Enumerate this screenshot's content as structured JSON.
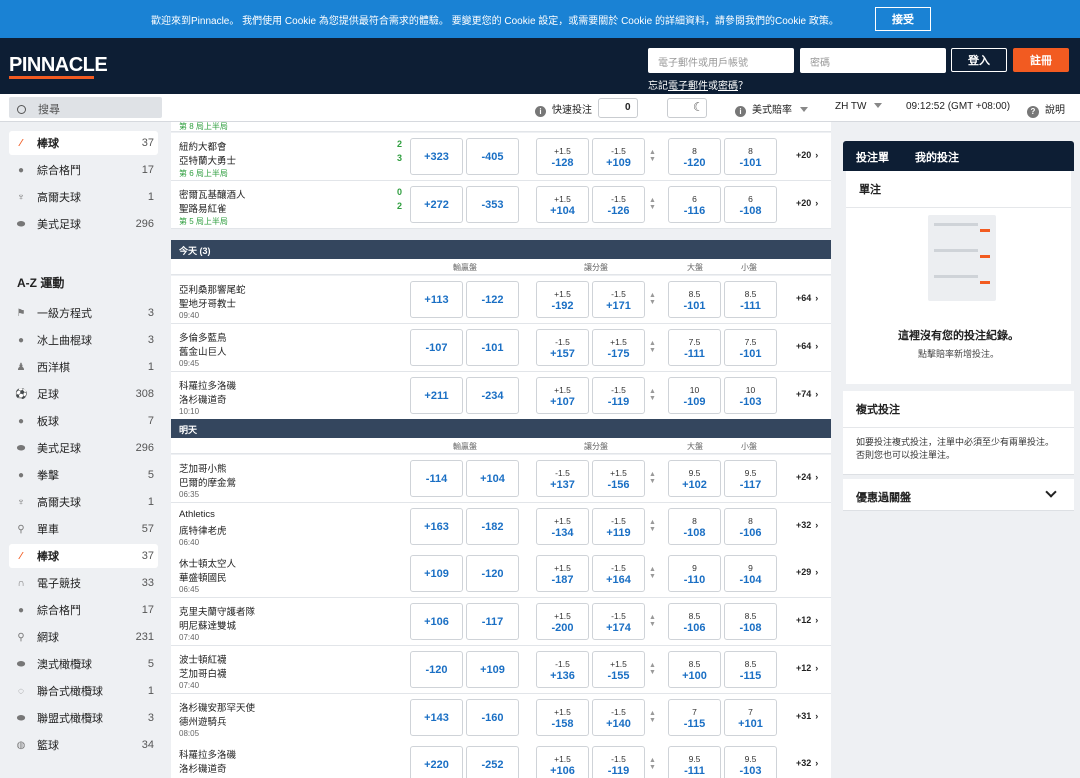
{
  "cookie": {
    "text": "歡迎來到Pinnacle。 我們使用 Cookie 為您提供最符合需求的體驗。 要變更您的 Cookie 設定，或需要關於 Cookie 的詳細資料，請參閱我們的Cookie 政策。",
    "accept": "接受"
  },
  "header": {
    "logo": "PINNACLE",
    "email_placeholder": "電子郵件或用戶帳號",
    "password_placeholder": "密碼",
    "login": "登入",
    "signup": "註冊",
    "forgot_prefix": "忘記",
    "forgot_email": "電子郵件",
    "forgot_or": "或",
    "forgot_password": "密碼",
    "forgot_suffix": "？"
  },
  "toolbar": {
    "search": "搜尋",
    "quick_bet": "快速投注",
    "quick_bet_value": "0",
    "odds_format": "美式賠率",
    "language": "ZH TW",
    "clock": "09:12:52 (GMT +08:00)",
    "help": "說明"
  },
  "sidebar": {
    "top": [
      {
        "label": "棒球",
        "count": "37",
        "icon": "baseball-bat-icon",
        "active": true
      },
      {
        "label": "綜合格鬥",
        "count": "17",
        "icon": "mma-glove-icon"
      },
      {
        "label": "高爾夫球",
        "count": "1",
        "icon": "golf-icon"
      },
      {
        "label": "美式足球",
        "count": "296",
        "icon": "football-icon"
      }
    ],
    "az_title": "A-Z 運動",
    "az": [
      {
        "label": "一級方程式",
        "count": "3",
        "icon": "racing-flag-icon"
      },
      {
        "label": "冰上曲棍球",
        "count": "3",
        "icon": "hockey-puck-icon"
      },
      {
        "label": "西洋棋",
        "count": "1",
        "icon": "chess-icon"
      },
      {
        "label": "足球",
        "count": "308",
        "icon": "soccer-ball-icon"
      },
      {
        "label": "板球",
        "count": "7",
        "icon": "cricket-ball-icon"
      },
      {
        "label": "美式足球",
        "count": "296",
        "icon": "football-icon"
      },
      {
        "label": "拳擊",
        "count": "5",
        "icon": "boxing-glove-icon"
      },
      {
        "label": "高爾夫球",
        "count": "1",
        "icon": "golf-icon"
      },
      {
        "label": "單車",
        "count": "57",
        "icon": "bicycle-icon"
      },
      {
        "label": "棒球",
        "count": "37",
        "icon": "baseball-bat-icon",
        "active": true
      },
      {
        "label": "電子競技",
        "count": "33",
        "icon": "headset-icon"
      },
      {
        "label": "綜合格鬥",
        "count": "17",
        "icon": "mma-glove-icon"
      },
      {
        "label": "網球",
        "count": "231",
        "icon": "tennis-racket-icon"
      },
      {
        "label": "澳式橄欖球",
        "count": "5",
        "icon": "aussie-rules-icon"
      },
      {
        "label": "聯合式橄欖球",
        "count": "1",
        "icon": "rugby-union-icon"
      },
      {
        "label": "聯盟式橄欖球",
        "count": "3",
        "icon": "rugby-league-icon"
      },
      {
        "label": "籃球",
        "count": "34",
        "icon": "basketball-icon"
      }
    ]
  },
  "main": {
    "live_header_partial": "第 8 局上半局",
    "live": [
      {
        "home": "紐約大都會",
        "away": "亞特蘭大勇士",
        "score_home": "2",
        "score_away": "3",
        "period": "第 6 局上半局",
        "ml": [
          "+323",
          "-405"
        ],
        "spread": [
          [
            "+1.5",
            "-128"
          ],
          [
            "-1.5",
            "+109"
          ]
        ],
        "total": [
          [
            "8",
            "-120"
          ],
          [
            "8",
            "-101"
          ]
        ],
        "more": "+20"
      },
      {
        "home": "密爾瓦基釀酒人",
        "away": "聖路易紅雀",
        "score_home": "0",
        "score_away": "2",
        "period": "第 5 局上半局",
        "ml": [
          "+272",
          "-353"
        ],
        "spread": [
          [
            "+1.5",
            "+104"
          ],
          [
            "-1.5",
            "-126"
          ]
        ],
        "total": [
          [
            "6",
            "-116"
          ],
          [
            "6",
            "-108"
          ]
        ],
        "more": "+20"
      }
    ],
    "today_label": "今天 (3)",
    "tomorrow_label": "明天",
    "col_ml": "輸贏盤",
    "col_spread": "讓分盤",
    "col_over": "大盤",
    "col_under": "小盤",
    "today": [
      {
        "home": "亞利桑那響尾蛇",
        "away": "聖地牙哥教士",
        "time": "09:40",
        "ml": [
          "+113",
          "-122"
        ],
        "spread": [
          [
            "+1.5",
            "-192"
          ],
          [
            "-1.5",
            "+171"
          ]
        ],
        "total": [
          [
            "8.5",
            "-101"
          ],
          [
            "8.5",
            "-111"
          ]
        ],
        "more": "+64"
      },
      {
        "home": "多倫多藍鳥",
        "away": "舊金山巨人",
        "time": "09:45",
        "ml": [
          "-107",
          "-101"
        ],
        "spread": [
          [
            "-1.5",
            "+157"
          ],
          [
            "+1.5",
            "-175"
          ]
        ],
        "total": [
          [
            "7.5",
            "-111"
          ],
          [
            "7.5",
            "-101"
          ]
        ],
        "more": "+64"
      },
      {
        "home": "科羅拉多洛磯",
        "away": "洛杉磯道奇",
        "time": "10:10",
        "ml": [
          "+211",
          "-234"
        ],
        "spread": [
          [
            "+1.5",
            "+107"
          ],
          [
            "-1.5",
            "-119"
          ]
        ],
        "total": [
          [
            "10",
            "-109"
          ],
          [
            "10",
            "-103"
          ]
        ],
        "more": "+74"
      }
    ],
    "tomorrow": [
      {
        "home": "芝加哥小熊",
        "away": "巴爾的摩金鶯",
        "time": "06:35",
        "ml": [
          "-114",
          "+104"
        ],
        "spread": [
          [
            "-1.5",
            "+137"
          ],
          [
            "+1.5",
            "-156"
          ]
        ],
        "total": [
          [
            "9.5",
            "+102"
          ],
          [
            "9.5",
            "-117"
          ]
        ],
        "more": "+24"
      },
      {
        "home": "Athletics",
        "away": "底特律老虎",
        "time": "06:40",
        "ml": [
          "+163",
          "-182"
        ],
        "spread": [
          [
            "+1.5",
            "-134"
          ],
          [
            "-1.5",
            "+119"
          ]
        ],
        "total": [
          [
            "8",
            "-108"
          ],
          [
            "8",
            "-106"
          ]
        ],
        "more": "+32"
      },
      {
        "home": "休士頓太空人",
        "away": "華盛頓國民",
        "time": "06:45",
        "ml": [
          "+109",
          "-120"
        ],
        "spread": [
          [
            "+1.5",
            "-187"
          ],
          [
            "-1.5",
            "+164"
          ]
        ],
        "total": [
          [
            "9",
            "-110"
          ],
          [
            "9",
            "-104"
          ]
        ],
        "more": "+29"
      },
      {
        "home": "克里夫蘭守護者隊",
        "away": "明尼蘇達雙城",
        "time": "07:40",
        "ml": [
          "+106",
          "-117"
        ],
        "spread": [
          [
            "+1.5",
            "-200"
          ],
          [
            "-1.5",
            "+174"
          ]
        ],
        "total": [
          [
            "8.5",
            "-106"
          ],
          [
            "8.5",
            "-108"
          ]
        ],
        "more": "+12"
      },
      {
        "home": "波士頓紅襪",
        "away": "芝加哥白襪",
        "time": "07:40",
        "ml": [
          "-120",
          "+109"
        ],
        "spread": [
          [
            "-1.5",
            "+136"
          ],
          [
            "+1.5",
            "-155"
          ]
        ],
        "total": [
          [
            "8.5",
            "+100"
          ],
          [
            "8.5",
            "-115"
          ]
        ],
        "more": "+12"
      },
      {
        "home": "洛杉磯安那罕天使",
        "away": "德州遊騎兵",
        "time": "08:05",
        "ml": [
          "+143",
          "-160"
        ],
        "spread": [
          [
            "+1.5",
            "-158"
          ],
          [
            "-1.5",
            "+140"
          ]
        ],
        "total": [
          [
            "7",
            "-115"
          ],
          [
            "7",
            "+101"
          ]
        ],
        "more": "+31"
      },
      {
        "home": "科羅拉多洛磯",
        "away": "洛杉磯道奇",
        "time": "",
        "ml": [
          "+220",
          "-252"
        ],
        "spread": [
          [
            "+1.5",
            "+106"
          ],
          [
            "-1.5",
            "-119"
          ]
        ],
        "total": [
          [
            "9.5",
            "-111"
          ],
          [
            "9.5",
            "-103"
          ]
        ],
        "more": "+32"
      }
    ]
  },
  "slip": {
    "tab_betslip": "投注單",
    "tab_mybets": "我的投注",
    "single": "單注",
    "empty_title": "這裡沒有您的投注紀錄。",
    "empty_sub": "點擊賠率新增投注。",
    "parlay": "複式投注",
    "parlay_text": "如要投注複式投注，注單中必須至少有兩單投注。否則您也可以投注單注。",
    "promo": "優惠過關盤"
  },
  "colors": {
    "accent": "#f25b21",
    "navy": "#0d1e34",
    "banner": "#1a82d4",
    "odds": "#1a6fc4",
    "live": "#2e9e3e"
  }
}
